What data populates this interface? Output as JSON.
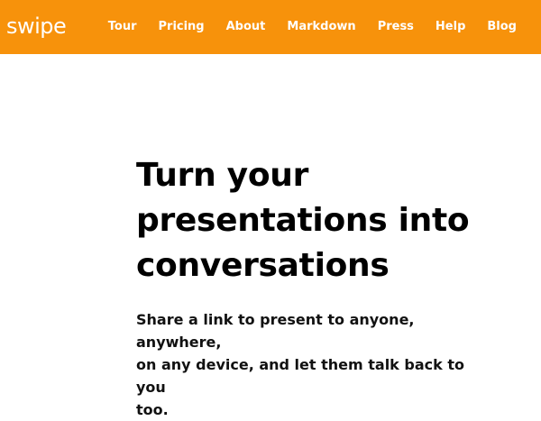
{
  "header": {
    "logo_text": "swipe",
    "nav": [
      {
        "label": "Tour"
      },
      {
        "label": "Pricing"
      },
      {
        "label": "About"
      },
      {
        "label": "Markdown"
      },
      {
        "label": "Press"
      },
      {
        "label": "Help"
      },
      {
        "label": "Blog"
      }
    ]
  },
  "hero": {
    "title_line1": "Turn your",
    "title_line2": "presentations into",
    "title_line3": "conversations",
    "subtitle_line1": "Share a link to present to anyone, anywhere,",
    "subtitle_line2": "on any device, and let them talk back to you",
    "subtitle_line3": "too."
  },
  "colors": {
    "header_background": "#f7920b",
    "header_text": "#ffffff",
    "body_text": "#000000",
    "page_background": "#ffffff"
  }
}
